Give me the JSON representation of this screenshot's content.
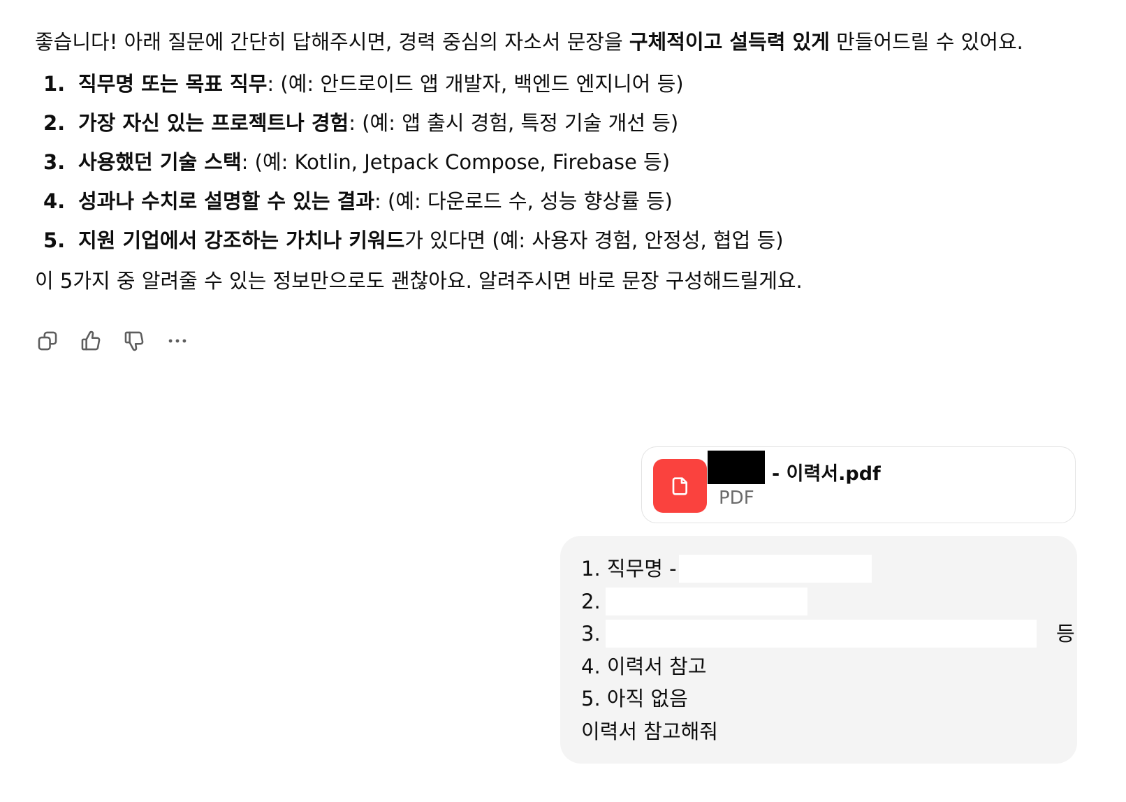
{
  "assistant": {
    "intro_pre": "좋습니다! 아래 질문에 간단히 답해주시면, 경력 중심의 자소서 문장을 ",
    "intro_bold": "구체적이고 설득력 있게",
    "intro_post": " 만들어드릴 수 있어요.",
    "items": [
      {
        "num": "1.",
        "bold": "직무명 또는 목표 직무",
        "rest": ": (예: 안드로이드 앱 개발자, 백엔드 엔지니어 등)"
      },
      {
        "num": "2.",
        "bold": "가장 자신 있는 프로젝트나 경험",
        "rest": ": (예: 앱 출시 경험, 특정 기술 개선 등)"
      },
      {
        "num": "3.",
        "bold": "사용했던 기술 스택",
        "rest": ": (예: Kotlin, Jetpack Compose, Firebase 등)"
      },
      {
        "num": "4.",
        "bold": "성과나 수치로 설명할 수 있는 결과",
        "rest": ": (예: 다운로드 수, 성능 향상률 등)"
      },
      {
        "num": "5.",
        "bold": "지원 기업에서 강조하는 가치나 키워드",
        "rest": "가 있다면 (예: 사용자 경험, 안정성, 협업 등)"
      }
    ],
    "outro": "이 5가지 중 알려줄 수 있는 정보만으로도 괜찮아요. 알려주시면 바로 문장 구성해드릴게요."
  },
  "actions": {
    "copy": "copy-icon",
    "like": "thumbs-up-icon",
    "dislike": "thumbs-down-icon",
    "more": "more-icon"
  },
  "attachment": {
    "name": "- 이력서.pdf",
    "type": "PDF",
    "icon": "document-icon",
    "icon_bg": "#fa423e"
  },
  "user": {
    "lines": [
      {
        "text": "1. 직무명 -"
      },
      {
        "text": "2."
      },
      {
        "text": "3.",
        "trail": "등"
      },
      {
        "text": "4. 이력서 참고"
      },
      {
        "text": "5. 아직 없음"
      },
      {
        "text": "이력서 참고해줘"
      }
    ]
  }
}
